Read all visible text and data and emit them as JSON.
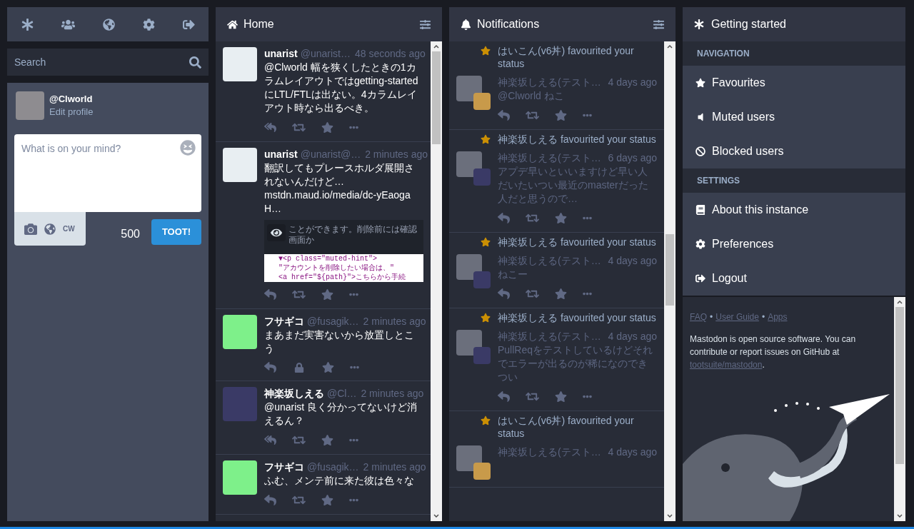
{
  "search": {
    "placeholder": "Search"
  },
  "compose": {
    "handle": "@Clworld",
    "edit_link": "Edit profile",
    "placeholder": "What is on your mind?",
    "cw_label": "CW",
    "counter": "500",
    "submit": "TOOT!"
  },
  "home": {
    "title": "Home",
    "statuses": [
      {
        "name": "unarist",
        "handle": "@unarist…",
        "time": "48 seconds ago",
        "color": "#e8eef2",
        "content": "@Clworld 幅を狭くしたときの1カラムレイアウトではgetting-startedにLTL/FTLは出ない。4カラムレイアウト時なら出るべき。",
        "thread": true,
        "locked": false
      },
      {
        "name": "unarist",
        "handle": "@unarist@…",
        "time": "2 minutes ago",
        "color": "#e8eef2",
        "content": "翻訳してもプレースホルダ展開されないんだけど…",
        "link": "mstdn.maud.io/media/dc-yEaogaH…",
        "media": {
          "lines": [
            {
              "kind": "page",
              "text": "ことができます。削除前には確認画面か"
            },
            {
              "kind": "code",
              "text": "▼<p class=\"muted-hint\">"
            },
            {
              "kind": "code",
              "text": "\"アカウントを削除したい場合は、\""
            },
            {
              "kind": "code",
              "text": "<a href=\"${path}\">こちらから手続"
            }
          ]
        },
        "thread": false,
        "locked": false
      },
      {
        "name": "フサギコ",
        "handle": "@fusagik…",
        "time": "2 minutes ago",
        "color": "#7ef08a",
        "content": "まあまだ実害ないから放置しとこう",
        "thread": false,
        "locked": true
      },
      {
        "name": "神楽坂しえる",
        "handle": "@Cl…",
        "time": "2 minutes ago",
        "color": "#3a3a66",
        "content": "@unarist 良く分かってないけど消えるん？",
        "thread": true,
        "locked": false
      },
      {
        "name": "フサギコ",
        "handle": "@fusagik…",
        "time": "2 minutes ago",
        "color": "#7ef08a",
        "content": "ふむ、メンテ前に来た彼は色々な",
        "thread": false,
        "locked": false
      }
    ]
  },
  "notifications": {
    "title": "Notifications",
    "items": [
      {
        "actor": "はいこん(v6丼)",
        "action": "favourited your status",
        "name": "神楽坂しえる(テスト…",
        "time": "4 days ago",
        "content": "@Clworld ねこ",
        "color": "#c89a4a"
      },
      {
        "actor": "神楽坂しえる",
        "action": "favourited your status",
        "name": "神楽坂しえる(テスト…",
        "time": "6 days ago",
        "content": "アプデ早いといいますけど早い人だいたいつい最近のmasterだった人だと思うので…",
        "color": "#3a3a66"
      },
      {
        "actor": "神楽坂しえる",
        "action": "favourited your status",
        "name": "神楽坂しえる(テスト…",
        "time": "4 days ago",
        "content": "ねこー",
        "color": "#3a3a66"
      },
      {
        "actor": "神楽坂しえる",
        "action": "favourited your status",
        "name": "神楽坂しえる(テスト…",
        "time": "4 days ago",
        "content": "PullReqをテストしているけどそれでエラーが出るのが稀になのできつい",
        "color": "#3a3a66"
      },
      {
        "actor": "はいこん(v6丼)",
        "action": "favourited your status",
        "name": "神楽坂しえる(テスト…",
        "time": "4 days ago",
        "color": "#c89a4a"
      }
    ]
  },
  "getting_started": {
    "title": "Getting started",
    "sections": [
      {
        "heading": "NAVIGATION",
        "items": [
          {
            "kind": "favourites",
            "label": "Favourites"
          },
          {
            "kind": "muted",
            "label": "Muted users"
          },
          {
            "kind": "blocked",
            "label": "Blocked users"
          }
        ]
      },
      {
        "heading": "SETTINGS",
        "items": [
          {
            "kind": "about",
            "label": "About this instance"
          },
          {
            "kind": "preferences",
            "label": "Preferences"
          },
          {
            "kind": "logout",
            "label": "Logout"
          }
        ]
      }
    ],
    "links": [
      "FAQ",
      "User Guide",
      "Apps"
    ],
    "separator": "•",
    "about": {
      "text": "Mastodon is open source software. You can contribute or report issues on GitHub at",
      "link": "tootsuite/mastodon",
      "end": "."
    }
  }
}
